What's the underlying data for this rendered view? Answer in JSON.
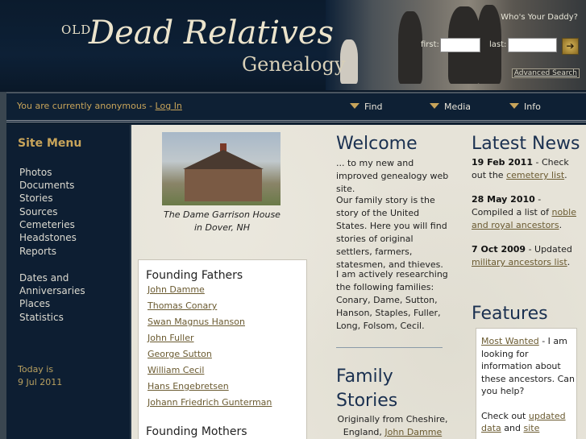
{
  "header": {
    "logo_old": "OLD",
    "logo_main": "Dead Relatives",
    "logo_sub": "Genealogy",
    "whos_daddy": "Who's Your Daddy?",
    "first_label": "first:",
    "last_label": "last:",
    "first_value": "",
    "last_value": "",
    "go_icon": "arrow-icon",
    "advanced_search": "Advanced Search"
  },
  "nav": {
    "anon_text": "You are currently anonymous",
    "sep": "-",
    "login": "Log In",
    "menus": [
      "Find",
      "Media",
      "Info"
    ]
  },
  "sidebar": {
    "title": "Site Menu",
    "items": [
      "Photos",
      "Documents",
      "Stories",
      "Sources",
      "Cemeteries",
      "Headstones",
      "Reports"
    ],
    "items2": [
      "Dates and",
      "Anniversaries",
      "Places",
      "Statistics"
    ],
    "today_label": "Today is",
    "today_date": "9 Jul 2011"
  },
  "main": {
    "caption_line1": "The Dame Garrison House",
    "caption_line2": "in Dover, NH",
    "founding_fathers": {
      "title": "Founding Fathers",
      "items": [
        "John Damme",
        "Thomas Conary",
        "Swan Magnus Hanson",
        "John Fuller",
        "George Sutton",
        "William Cecil",
        "Hans Engebretsen",
        "Johann Friedrich Gunterman"
      ]
    },
    "founding_mothers_title": "Founding Mothers",
    "welcome": {
      "title": "Welcome",
      "p1": "... to my new and improved genealogy web site.",
      "p2": "Our family story is the story of the United States. Here you will find stories of original settlers, farmers, statesmen, and thieves.",
      "p3": "I am actively researching the following families: Conary, Dame, Sutton, Hanson, Staples, Fuller, Long, Folsom, Cecil."
    },
    "family_stories": {
      "title_line1": "Family",
      "title_line2": "Stories",
      "text_line1": "Originally from Cheshire,",
      "text_line2_pre": "England,",
      "text_link": "John Damme"
    },
    "news": {
      "title": "Latest News",
      "items": [
        {
          "date": "19 Feb 2011",
          "pre": "- Check out the",
          "link": "cemetery list",
          "post": "."
        },
        {
          "date": "28 May 2010",
          "pre": "- Compiled a list of",
          "link": "noble and royal ancestors",
          "post": "."
        },
        {
          "date": "7 Oct 2009",
          "pre": "- Updated",
          "link": "military ancestors list",
          "post": "."
        }
      ]
    },
    "features": {
      "title": "Features",
      "link1": "Most Wanted",
      "text1": "- I am looking for information about these ancestors. Can you help?",
      "text2_pre": "Check out",
      "link2": "updated data",
      "text2_mid": "and",
      "link3": "site"
    }
  }
}
